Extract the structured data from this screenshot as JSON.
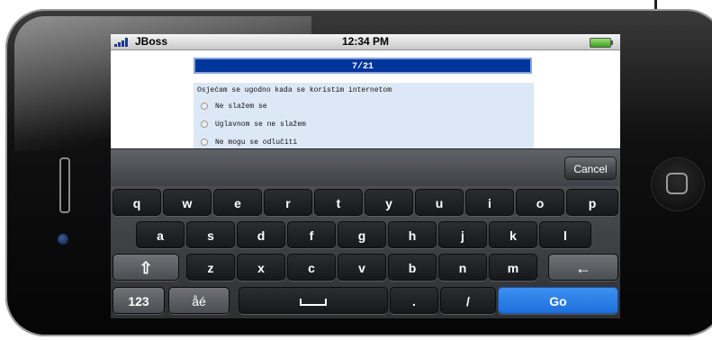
{
  "status_bar": {
    "carrier": "JBoss",
    "time": "12:34 PM"
  },
  "page": {
    "counter": "7/21",
    "question": "Osjećam se ugodno kada se koristim internetom",
    "options": [
      "Ne slažem se",
      "Uglavnom se ne slažem",
      "Ne mogu se odlučiti"
    ]
  },
  "keyboard": {
    "cancel_label": "Cancel",
    "row1": [
      "q",
      "w",
      "e",
      "r",
      "t",
      "y",
      "u",
      "i",
      "o",
      "p"
    ],
    "row2": [
      "a",
      "s",
      "d",
      "f",
      "g",
      "h",
      "j",
      "k",
      "l"
    ],
    "row3": [
      "z",
      "x",
      "c",
      "v",
      "b",
      "n",
      "m"
    ],
    "shift_symbol": "⇧",
    "backspace_symbol": "←",
    "numbers_label": "123",
    "intl_label": "åé",
    "period_label": ".",
    "slash_label": "/",
    "go_label": "Go",
    "accent_color": "#2f7fe8"
  }
}
